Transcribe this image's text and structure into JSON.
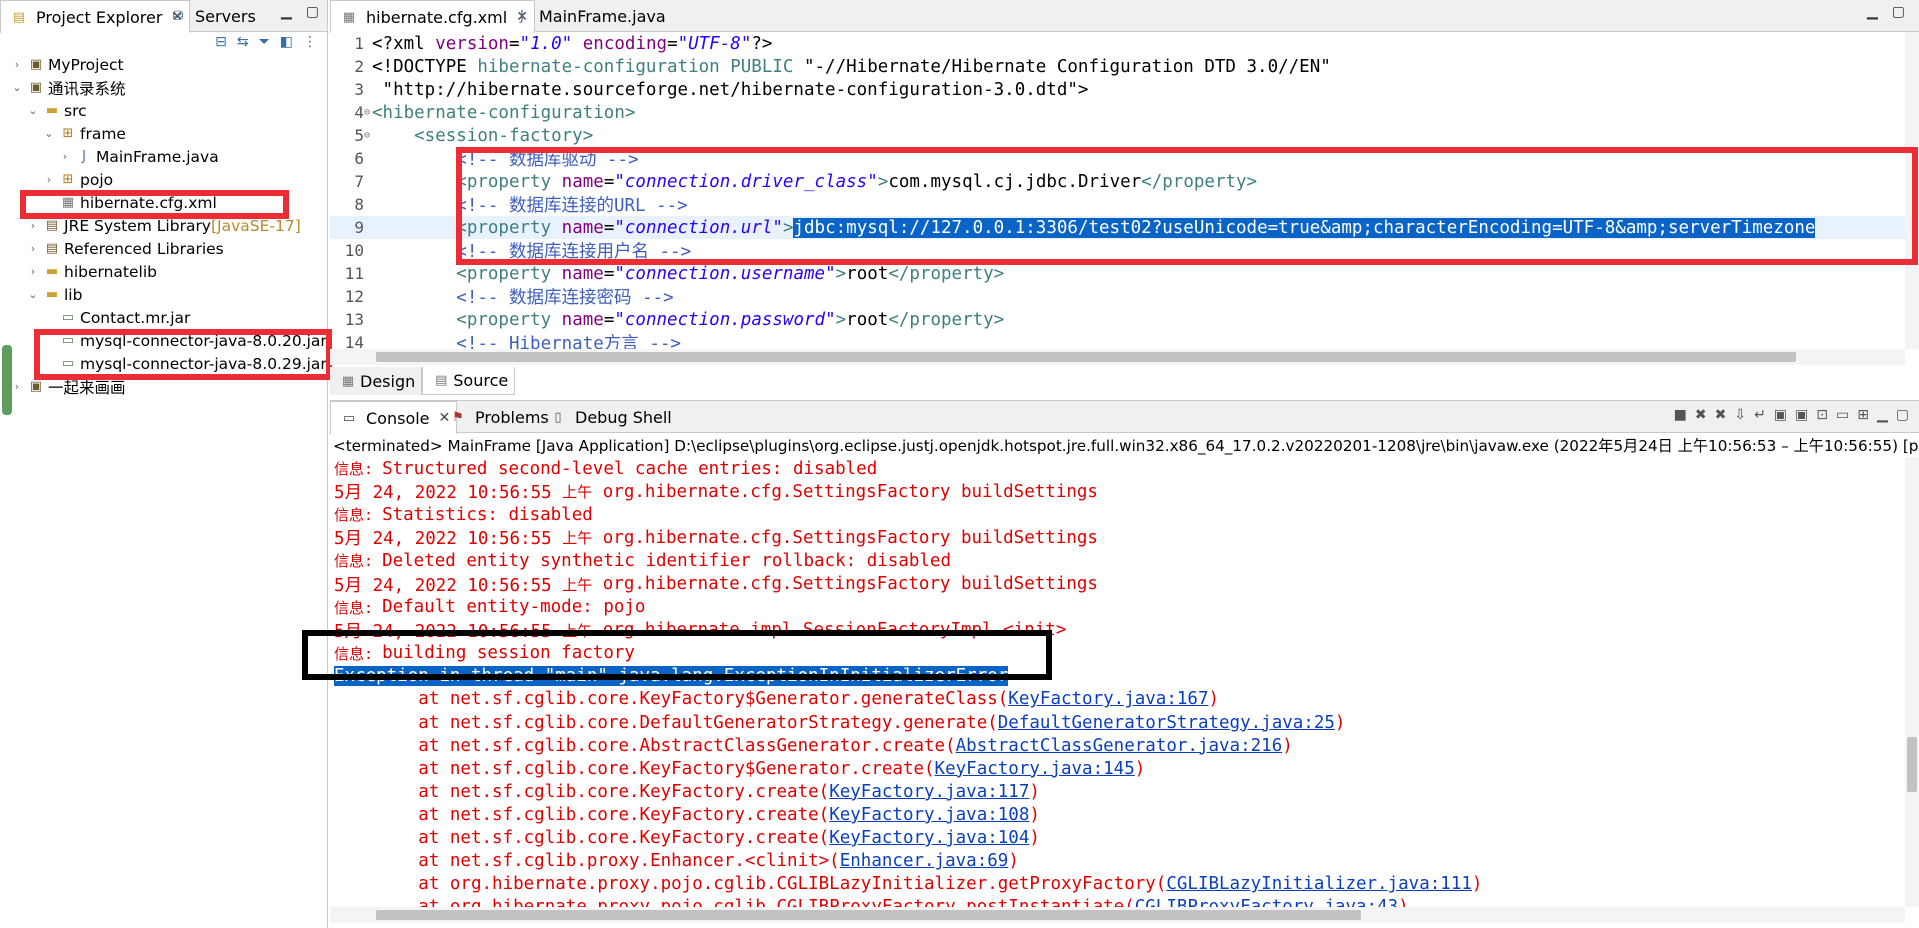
{
  "left": {
    "tabs": [
      {
        "label": "Project Explorer",
        "active": true
      },
      {
        "label": "Servers",
        "active": false
      }
    ],
    "tree": [
      {
        "indent": 0,
        "twisty": "›",
        "icon": "project-icon",
        "cls": "proj",
        "label": "MyProject"
      },
      {
        "indent": 0,
        "twisty": "⌄",
        "icon": "project-icon",
        "cls": "proj",
        "label": "通讯录系统"
      },
      {
        "indent": 1,
        "twisty": "⌄",
        "icon": "source-folder-icon",
        "cls": "folder",
        "label": "src"
      },
      {
        "indent": 2,
        "twisty": "⌄",
        "icon": "package-icon",
        "cls": "pkg",
        "label": "frame"
      },
      {
        "indent": 3,
        "twisty": "›",
        "icon": "java-file-icon",
        "cls": "java",
        "label": "MainFrame.java"
      },
      {
        "indent": 2,
        "twisty": "›",
        "icon": "package-icon",
        "cls": "pkg",
        "label": "pojo"
      },
      {
        "indent": 2,
        "twisty": "",
        "icon": "xml-file-icon",
        "cls": "xml",
        "label": "hibernate.cfg.xml"
      },
      {
        "indent": 1,
        "twisty": "›",
        "icon": "library-icon",
        "cls": "lib",
        "label": "JRE System Library",
        "extra": "[JavaSE-17]"
      },
      {
        "indent": 1,
        "twisty": "›",
        "icon": "library-icon",
        "cls": "lib",
        "label": "Referenced Libraries"
      },
      {
        "indent": 1,
        "twisty": "›",
        "icon": "folder-icon",
        "cls": "folder",
        "label": "hibernatelib"
      },
      {
        "indent": 1,
        "twisty": "⌄",
        "icon": "folder-icon",
        "cls": "folder",
        "label": "lib"
      },
      {
        "indent": 2,
        "twisty": "",
        "icon": "jar-icon",
        "cls": "jar",
        "label": "Contact.mr.jar"
      },
      {
        "indent": 2,
        "twisty": "",
        "icon": "jar-icon",
        "cls": "jar",
        "label": "mysql-connector-java-8.0.20.jar"
      },
      {
        "indent": 2,
        "twisty": "",
        "icon": "jar-icon",
        "cls": "jar",
        "label": "mysql-connector-java-8.0.29.jar"
      },
      {
        "indent": 0,
        "twisty": "›",
        "icon": "project-icon",
        "cls": "proj",
        "label": "一起来画画"
      }
    ]
  },
  "editor": {
    "tabs": [
      {
        "label": "hibernate.cfg.xml",
        "active": true
      },
      {
        "label": "MainFrame.java",
        "active": false
      }
    ],
    "lines": [
      {
        "n": "1",
        "html": "<span class='ct'>&lt;?xml </span><span class='at'>version</span><span class='ct'>=</span><span class='av'>\"1.0\"</span><span class='ct'> </span><span class='at'>encoding</span><span class='ct'>=</span><span class='av'>\"UTF-8\"</span><span class='ct'>?&gt;</span>"
      },
      {
        "n": "2",
        "html": "<span class='ct'>&lt;!DOCTYPE </span><span class='kw'>hibernate-configuration</span><span class='ct'> </span><span class='kw'>PUBLIC</span><span class='ct'> \"-//Hibernate/Hibernate Configuration DTD 3.0//EN\"</span>"
      },
      {
        "n": "3",
        "html": "<span class='ct'> \"http://hibernate.sourceforge.net/hibernate-configuration-3.0.dtd\"&gt;</span>"
      },
      {
        "n": "4",
        "fold": "⊖",
        "html": "<span class='tg'>&lt;hibernate-configuration&gt;</span>"
      },
      {
        "n": "5",
        "fold": "⊖",
        "html": "<span class='tg'>    &lt;session-factory&gt;</span>"
      },
      {
        "n": "6",
        "html": "<span class='cm'>        &lt;!-- 数据库驱动 --&gt;</span>"
      },
      {
        "n": "7",
        "html": "<span class='tg'>        &lt;property </span><span class='at'>name</span><span class='ct'>=</span><span class='av'>\"connection.driver_class\"</span><span class='tg'>&gt;</span><span class='ct'>com.mysql.cj.jdbc.Driver</span><span class='tg'>&lt;/property&gt;</span>"
      },
      {
        "n": "8",
        "html": "<span class='cm'>        &lt;!-- 数据库连接的URL --&gt;</span>"
      },
      {
        "n": "9",
        "hl": true,
        "html": "<span class='tg'>        &lt;property </span><span class='at'>name</span><span class='ct'>=</span><span class='av'>\"connection.url\"</span><span class='tg'>&gt;</span><span class='sel'>jdbc:mysql://127.0.0.1:3306/test02?useUnicode=true&amp;amp;characterEncoding=UTF-8&amp;amp;serverTimezone</span>"
      },
      {
        "n": "10",
        "html": "<span class='cm'>        &lt;!-- 数据库连接用户名 --&gt;</span>"
      },
      {
        "n": "11",
        "html": "<span class='tg'>        &lt;property </span><span class='at'>name</span><span class='ct'>=</span><span class='av'>\"connection.username\"</span><span class='tg'>&gt;</span><span class='ct'>root</span><span class='tg'>&lt;/property&gt;</span>"
      },
      {
        "n": "12",
        "html": "<span class='cm'>        &lt;!-- 数据库连接密码 --&gt;</span>"
      },
      {
        "n": "13",
        "html": "<span class='tg'>        &lt;property </span><span class='at'>name</span><span class='ct'>=</span><span class='av'>\"connection.password\"</span><span class='tg'>&gt;</span><span class='ct'>root</span><span class='tg'>&lt;/property&gt;</span>"
      },
      {
        "n": "14",
        "html": "<span class='cm'>        &lt;!-- Hibernate方言 --&gt;</span>"
      }
    ],
    "bottom_tabs": [
      {
        "label": "Design",
        "active": false
      },
      {
        "label": "Source",
        "active": true
      }
    ]
  },
  "console": {
    "tabs": [
      {
        "label": "Console",
        "active": true
      },
      {
        "label": "Problems",
        "active": false
      },
      {
        "label": "Debug Shell",
        "active": false
      }
    ],
    "terminated": "<terminated> MainFrame [Java Application] D:\\eclipse\\plugins\\org.eclipse.justj.openjdk.hotspot.jre.full.win32.x86_64_17.0.2.v20220201-1208\\jre\\bin\\javaw.exe  (2022年5月24日 上午10:56:53 – 上午10:56:55) [pid: 10308]",
    "lines": [
      {
        "html": "<span class='cjk'>信息: </span>Structured second-level cache entries: disabled"
      },
      {
        "html": "5月 24, 2022 10:56:55 <span class='cjk'>上午</span> org.hibernate.cfg.SettingsFactory buildSettings"
      },
      {
        "html": "<span class='cjk'>信息: </span>Statistics: disabled"
      },
      {
        "html": "5月 24, 2022 10:56:55 <span class='cjk'>上午</span> org.hibernate.cfg.SettingsFactory buildSettings"
      },
      {
        "html": "<span class='cjk'>信息: </span>Deleted entity synthetic identifier rollback: disabled"
      },
      {
        "html": "5月 24, 2022 10:56:55 <span class='cjk'>上午</span> org.hibernate.cfg.SettingsFactory buildSettings"
      },
      {
        "html": "<span class='cjk'>信息: </span>Default entity-mode: pojo"
      },
      {
        "html": "5月 24, 2022 10:56:55 <span class='cjk'>上午</span> org.hibernate.impl.SessionFactoryImpl &lt;init&gt;"
      },
      {
        "html": "<span class='cjk'>信息: </span>building session factory"
      },
      {
        "html": "<span class='selx'>Exception in thread \"main\" java.lang.ExceptionInInitializerError</span>"
      },
      {
        "html": "        at net.sf.cglib.core.KeyFactory$Generator.generateClass(<a>KeyFactory.java:167</a>)"
      },
      {
        "html": "        at net.sf.cglib.core.DefaultGeneratorStrategy.generate(<a>DefaultGeneratorStrategy.java:25</a>)"
      },
      {
        "html": "        at net.sf.cglib.core.AbstractClassGenerator.create(<a>AbstractClassGenerator.java:216</a>)"
      },
      {
        "html": "        at net.sf.cglib.core.KeyFactory$Generator.create(<a>KeyFactory.java:145</a>)"
      },
      {
        "html": "        at net.sf.cglib.core.KeyFactory.create(<a>KeyFactory.java:117</a>)"
      },
      {
        "html": "        at net.sf.cglib.core.KeyFactory.create(<a>KeyFactory.java:108</a>)"
      },
      {
        "html": "        at net.sf.cglib.core.KeyFactory.create(<a>KeyFactory.java:104</a>)"
      },
      {
        "html": "        at net.sf.cglib.proxy.Enhancer.&lt;clinit&gt;(<a>Enhancer.java:69</a>)"
      },
      {
        "html": "        at org.hibernate.proxy.pojo.cglib.CGLIBLazyInitializer.getProxyFactory(<a>CGLIBLazyInitializer.java:111</a>)"
      },
      {
        "html": "        at org.hibernate.proxy.pojo.cglib.CGLIBProxyFactory.postInstantiate(<a>CGLIBProxyFactory.java:43</a>)"
      }
    ]
  }
}
